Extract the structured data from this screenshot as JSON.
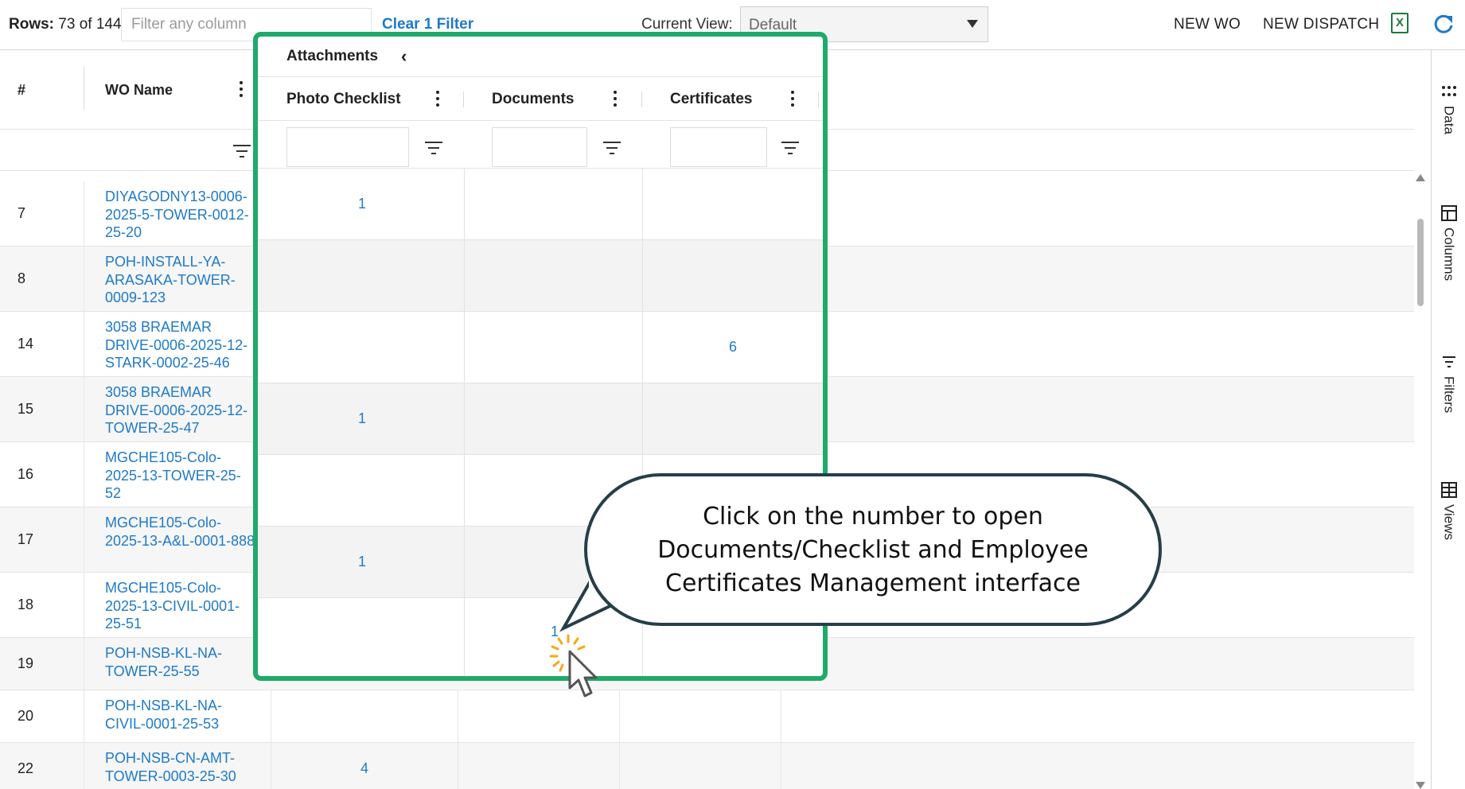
{
  "toolbar": {
    "rows_label": "Rows:",
    "rows_value": "73 of 144",
    "filter_placeholder": "Filter any column",
    "clear_filter": "Clear 1 Filter",
    "current_view_label": "Current View:",
    "current_view_value": "Default",
    "new_wo": "NEW WO",
    "new_dispatch": "NEW DISPATCH",
    "excel_icon": "excel-icon",
    "refresh_icon": "refresh-icon"
  },
  "side_panel": {
    "items": [
      {
        "label": "Data",
        "icon": "dots-grid-icon"
      },
      {
        "label": "Columns",
        "icon": "columns-icon"
      },
      {
        "label": "Filters",
        "icon": "filter-icon"
      },
      {
        "label": "Views",
        "icon": "table-icon"
      }
    ]
  },
  "grid": {
    "columns": {
      "hash": "#",
      "wo_name": "WO Name"
    },
    "rows": [
      {
        "num": "7",
        "wo": "DIYAGODNY13-0006-2025-5-TOWER-0012-25-20"
      },
      {
        "num": "8",
        "wo": "POH-INSTALL-YA-ARASAKA-TOWER-0009-123"
      },
      {
        "num": "14",
        "wo": "3058 BRAEMAR DRIVE-0006-2025-12-STARK-0002-25-46"
      },
      {
        "num": "15",
        "wo": "3058 BRAEMAR DRIVE-0006-2025-12-TOWER-25-47"
      },
      {
        "num": "16",
        "wo": "MGCHE105-Colo-2025-13-TOWER-25-52"
      },
      {
        "num": "17",
        "wo": "MGCHE105-Colo-2025-13-A&L-0001-888"
      },
      {
        "num": "18",
        "wo": "MGCHE105-Colo-2025-13-CIVIL-0001-25-51"
      },
      {
        "num": "19",
        "wo": "POH-NSB-KL-NA-TOWER-25-55"
      },
      {
        "num": "20",
        "wo": "POH-NSB-KL-NA-CIVIL-0001-25-53"
      },
      {
        "num": "22",
        "wo": "POH-NSB-CN-AMT-TOWER-0003-25-30",
        "photo": "4"
      }
    ]
  },
  "attachments": {
    "title": "Attachments",
    "columns": [
      "Photo Checklist",
      "Documents",
      "Certificates"
    ],
    "rows": [
      {
        "photo": "1",
        "documents": "",
        "certificates": ""
      },
      {
        "photo": "",
        "documents": "",
        "certificates": ""
      },
      {
        "photo": "",
        "documents": "",
        "certificates": "6"
      },
      {
        "photo": "1",
        "documents": "",
        "certificates": ""
      },
      {
        "photo": "",
        "documents": "",
        "certificates": ""
      },
      {
        "photo": "1",
        "documents": "",
        "certificates": ""
      },
      {
        "photo": "",
        "documents": "1",
        "certificates": ""
      }
    ]
  },
  "callout": {
    "line1": "Click on the number to open",
    "line2": "Documents/Checklist and Employee",
    "line3": "Certificates Management interface"
  },
  "colors": {
    "highlight": "#1faa6a",
    "link": "#1e7ac8",
    "callout_border": "#263e47"
  }
}
